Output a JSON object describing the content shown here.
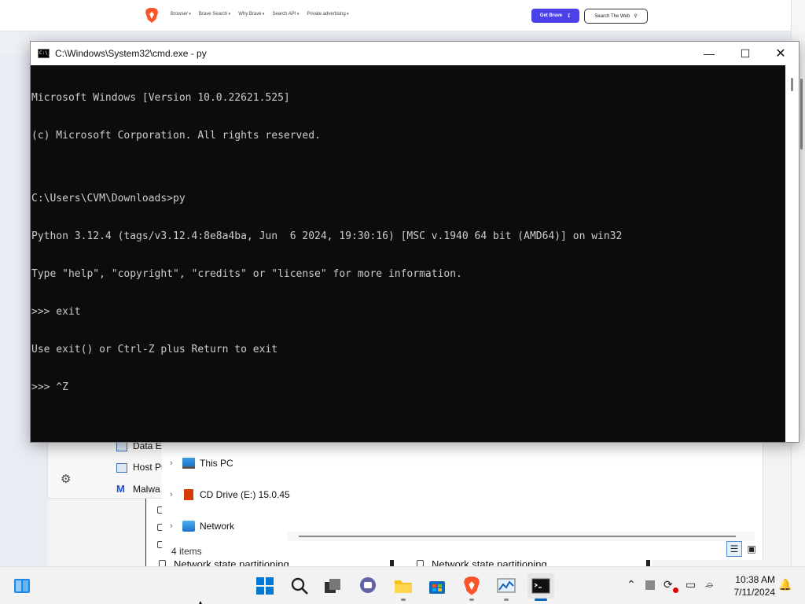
{
  "website": {
    "nav": [
      "Browser",
      "Brave Search",
      "Why Brave",
      "Search API",
      "Private advertising"
    ],
    "get_brave": "Get Brave",
    "search_the_web": "Search The Web",
    "brand_color": "#fb542b",
    "accent_color": "#4a42e8"
  },
  "settings": {
    "option_left": "Network state partitioning",
    "option_right": "Network state partitioning"
  },
  "explorer": {
    "nav_items": [
      "Data Ex",
      "Host Pr",
      "Malwa"
    ],
    "tree": [
      {
        "label": "This PC",
        "icon": "monitor-icon"
      },
      {
        "label": "CD Drive (E:) 15.0.45",
        "icon": "office-disc-icon"
      },
      {
        "label": "Network",
        "icon": "network-icon"
      }
    ],
    "status": "4 items"
  },
  "cmd": {
    "title": "C:\\Windows\\System32\\cmd.exe - py",
    "lines": [
      "Microsoft Windows [Version 10.0.22621.525]",
      "(c) Microsoft Corporation. All rights reserved.",
      "",
      "C:\\Users\\CVM\\Downloads>py",
      "Python 3.12.4 (tags/v3.12.4:8e8a4ba, Jun  6 2024, 19:30:16) [MSC v.1940 64 bit (AMD64)] on win32",
      "Type \"help\", \"copyright\", \"credits\" or \"license\" for more information.",
      ">>> exit",
      "Use exit() or Ctrl-Z plus Return to exit",
      ">>> ^Z"
    ],
    "text_color": "#cccccc",
    "background": "#0c0c0c"
  },
  "taskbar": {
    "apps": [
      "start-icon",
      "search-icon",
      "task-view-icon",
      "chat-icon",
      "file-explorer-icon",
      "microsoft-store-icon",
      "brave-icon",
      "performance-monitor-icon",
      "terminal-icon"
    ],
    "active_app": "terminal-icon",
    "clock": {
      "time": "10:38 AM",
      "date": "7/11/2024"
    }
  }
}
